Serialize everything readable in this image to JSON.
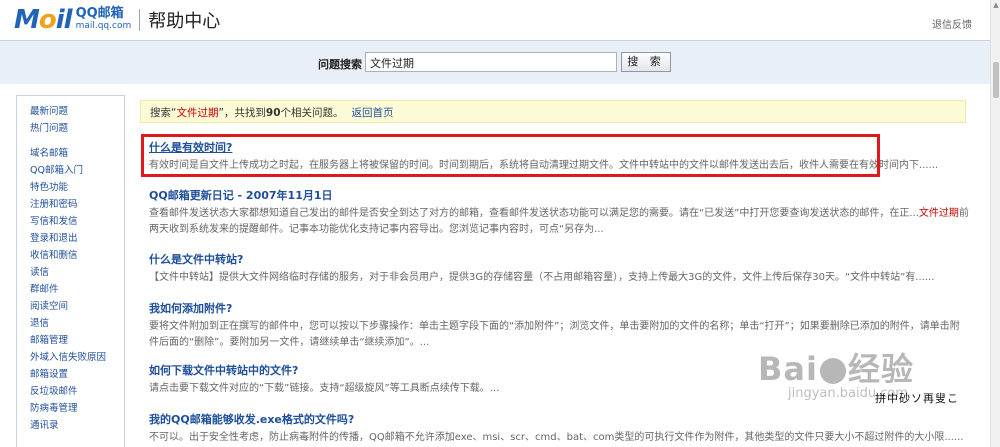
{
  "header": {
    "logo_text_m": "M",
    "logo_text_o": "o",
    "logo_text_il": "il",
    "logo_qq": "QQ邮箱",
    "logo_domain": "mail.qq.com",
    "title": "帮助中心",
    "feedback": "退信反馈"
  },
  "search": {
    "label": "问题搜索",
    "value": "文件过期",
    "button": "搜 索"
  },
  "sidebar": {
    "items": [
      "最新问题",
      "热门问题",
      "域名邮箱",
      "QQ邮箱入门",
      "特色功能",
      "注册和密码",
      "写信和发信",
      "登录和退出",
      "收信和删信",
      "读信",
      "群邮件",
      "阅读空间",
      "退信",
      "邮箱管理",
      "外域入信失败原因",
      "邮箱设置",
      "反垃圾邮件",
      "防病毒管理",
      "通讯录"
    ]
  },
  "notice": {
    "prefix": "搜索“",
    "keyword": "文件过期",
    "middle": "”，共找到",
    "count": "90",
    "suffix": "个相关问题。",
    "back": "返回首页"
  },
  "results": [
    {
      "title": "什么是有效时间?",
      "desc": "有效时间是自文件上传成功之时起，在服务器上将被保留的时间。时间到期后，系统将自动清理过期文件。文件中转站中的文件以邮件发送出去后，收件人需要在有效时间内下......"
    },
    {
      "title": "QQ邮箱更新日记 - 2007年11月1日",
      "desc_a": "查看邮件发送状态大家都想知道自己发出的邮件是否安全到达了对方的邮箱，查看邮件发送状态功能可以满足您的需要。请在“已发送”中打开您要查询发送状态的邮件，在正...",
      "desc_hl": "文件过期",
      "desc_b": "前两天收到系统发来的提醒邮件。记事本功能优化支持记事内容导出。您浏览记事内容时，可点“另存为..."
    },
    {
      "title": "什么是文件中转站?",
      "desc": "【文件中转站】提供大文件网络临时存储的服务，对于非会员用户，提供3G的存储容量（不占用邮箱容量），支持上传最大3G的文件，文件上传后保存30天。“文件中转站”有......"
    },
    {
      "title": "我如何添加附件?",
      "desc": "要将文件附加到正在撰写的邮件中，您可以按以下步骤操作：单击主题字段下面的“添加附件”；浏览文件，单击要附加的文件的名称；单击“打开”；如果要删除已添加的附件，请单击附件后面的“删除”。要附加另一文件，请继续单击“继续添加”。..."
    },
    {
      "title": "如何下载文件中转站中的文件?",
      "desc": "请点击要下载文件对应的“下载”链接。支持“超级旋风”等工具断点续传下载。..."
    },
    {
      "title": "我的QQ邮箱能够收发.exe格式的文件吗?",
      "desc": "不可以。出于安全性考虑，防止病毒附件的传播，QQ邮箱不允许添加exe、msi、scr、cmd、bat、com类型的可执行文件作为附件，其他类型的文件只要大小不超过附件的大小限......"
    }
  ],
  "watermark": {
    "main_a": "Bai",
    "main_b": "经验",
    "sub": "jingyan.baidu.com"
  },
  "stamp": "拼中砂ソ再叟こ"
}
